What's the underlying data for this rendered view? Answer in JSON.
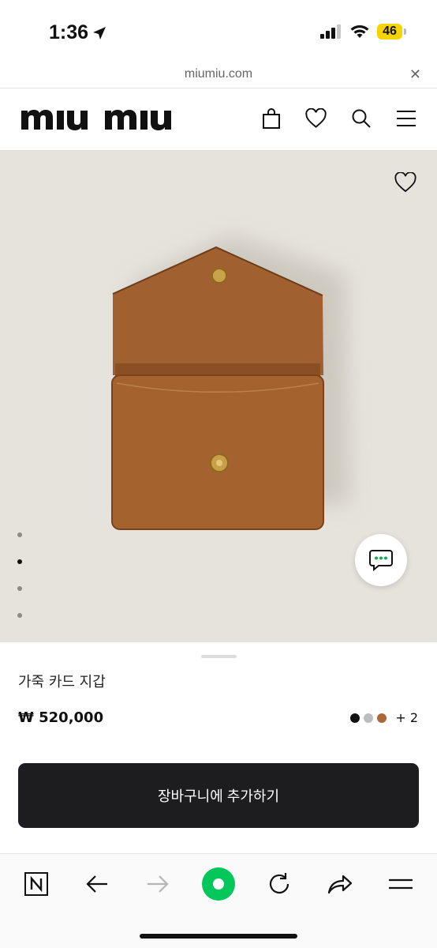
{
  "status_bar": {
    "time": "1:36",
    "battery": "46",
    "icons": [
      "location-arrow-icon",
      "cellular-signal-icon",
      "wifi-icon",
      "battery-icon"
    ]
  },
  "browser": {
    "url": "miumiu.com",
    "close_icon": "close-icon"
  },
  "header": {
    "logo_text": "miu miu",
    "icons": [
      "bag-icon",
      "heart-icon",
      "search-icon",
      "menu-icon"
    ]
  },
  "product": {
    "name": "가죽 카드 지갑",
    "price": "₩ 520,000",
    "more_colors": "+ 2",
    "swatch_colors": [
      "#111111",
      "#bdbdbd",
      "#a9683a"
    ],
    "image_background": "#e6e3dd",
    "leather_color": "#9c5a2c",
    "carousel_count": 4,
    "carousel_active_index": 1
  },
  "actions": {
    "add_to_cart": "장바구니에 추가하기"
  },
  "toolbar": {
    "items": [
      "n-icon",
      "back-arrow-icon",
      "forward-arrow-icon",
      "green-dot-icon",
      "reload-icon",
      "share-icon",
      "menu-lines-icon"
    ],
    "accent": "#03c75a"
  }
}
